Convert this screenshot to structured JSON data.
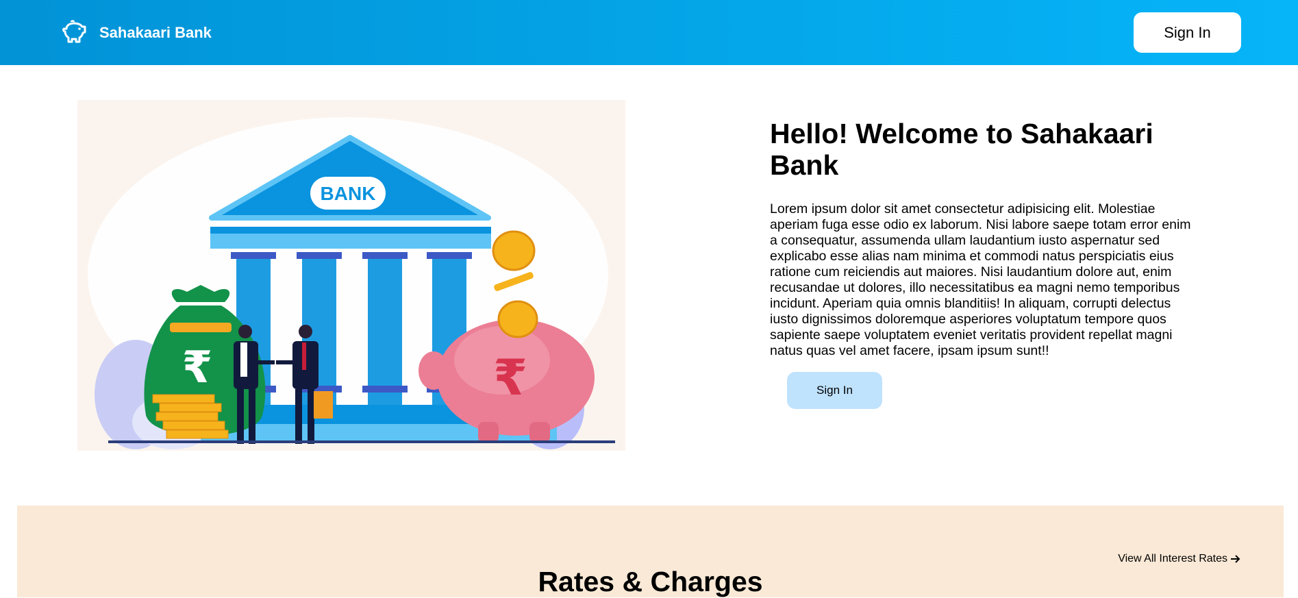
{
  "header": {
    "brand_name": "Sahakaari Bank",
    "brand_icon": "piggy-bank-icon",
    "signin_label": "Sign In"
  },
  "hero": {
    "title": "Hello! Welcome to Sahakaari Bank",
    "paragraph": "Lorem ipsum dolor sit amet consectetur adipisicing elit. Molestiae aperiam fuga esse odio ex laborum. Nisi labore saepe totam error enim a consequatur, assumenda ullam laudantium iusto aspernatur sed explicabo esse alias nam minima et commodi natus perspiciatis eius ratione cum reiciendis aut maiores. Nisi laudantium dolore aut, enim recusandae ut dolores, illo necessitatibus ea magni nemo temporibus incidunt. Aperiam quia omnis blanditiis! In aliquam, corrupti delectus iusto dignissimos doloremque asperiores voluptatum tempore quos sapiente saepe voluptatem eveniet veritatis provident repellat magni natus quas vel amet facere, ipsam ipsum sunt!!",
    "signin_label": "Sign In",
    "illustration": {
      "bank_sign": "BANK",
      "currency_symbol": "₹"
    }
  },
  "rates": {
    "title": "Rates & Charges",
    "link_label": "View All Interest Rates",
    "link_icon": "arrow-right-icon"
  },
  "colors": {
    "header_start": "#0292d6",
    "header_end": "#06b4f8",
    "hero_button": "#bfe2fd",
    "rates_bg": "#f9e9d6"
  }
}
